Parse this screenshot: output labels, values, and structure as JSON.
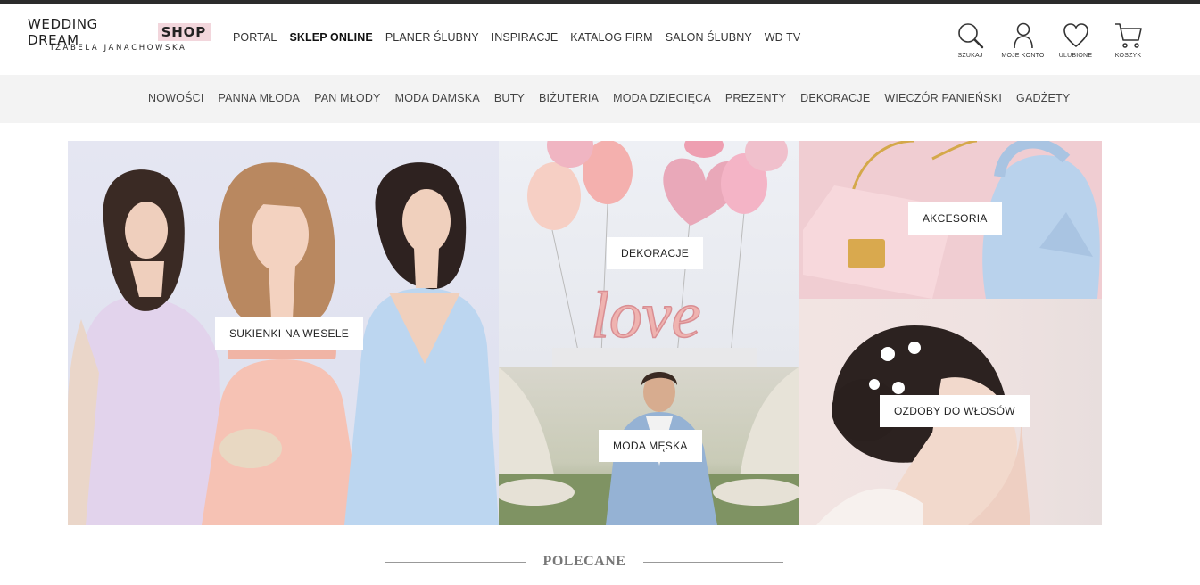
{
  "logo": {
    "main": "WEDDING DREAM",
    "shop": "SHOP",
    "sub": "IZABELA JANACHOWSKA"
  },
  "main_nav": [
    {
      "label": "PORTAL",
      "active": false
    },
    {
      "label": "SKLEP ONLINE",
      "active": true
    },
    {
      "label": "PLANER ŚLUBNY",
      "active": false
    },
    {
      "label": "INSPIRACJE",
      "active": false
    },
    {
      "label": "KATALOG FIRM",
      "active": false
    },
    {
      "label": "SALON ŚLUBNY",
      "active": false
    },
    {
      "label": "WD TV",
      "active": false
    }
  ],
  "header_icons": [
    {
      "label": "SZUKAJ",
      "icon": "search-icon"
    },
    {
      "label": "MOJE KONTO",
      "icon": "user-icon"
    },
    {
      "label": "ULUBIONE",
      "icon": "heart-icon"
    },
    {
      "label": "KOSZYK",
      "icon": "cart-icon"
    }
  ],
  "categories": [
    "NOWOŚCI",
    "PANNA MŁODA",
    "PAN MŁODY",
    "MODA DAMSKA",
    "BUTY",
    "BIŻUTERIA",
    "MODA DZIECIĘCA",
    "PREZENTY",
    "DEKORACJE",
    "WIECZÓR PANIEŃSKI",
    "GADŻETY"
  ],
  "tiles": {
    "sukienki": "SUKIENKI NA WESELE",
    "dekoracje": "DEKORACJE",
    "moda_meska": "MODA MĘSKA",
    "akcesoria": "AKCESORIA",
    "ozdoby": "OZDOBY DO WŁOSÓW",
    "love_text": "love"
  },
  "section": {
    "title": "POLECANE"
  },
  "colors": {
    "shop_badge": "#f2d6dc",
    "category_bar": "#f3f3f3",
    "top_strip": "#2b2b2b"
  }
}
